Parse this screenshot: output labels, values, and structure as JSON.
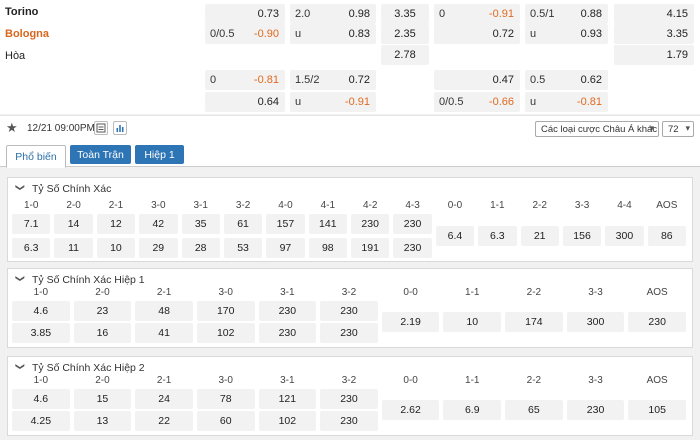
{
  "teams": {
    "home": "Torino",
    "away": "Bologna",
    "draw": "Hòa"
  },
  "odds": {
    "r1": {
      "a": "0.73",
      "b_l": "2.0",
      "b_r": "0.98",
      "c": "3.35",
      "d_l": "0",
      "d_r": "-0.91",
      "e_l": "0.5/1",
      "e_r": "0.88",
      "f": "4.15"
    },
    "r2": {
      "a_l": "0/0.5",
      "a_r": "-0.90",
      "b_l": "u",
      "b_r": "0.83",
      "c": "2.35",
      "d_r": "0.72",
      "e_l": "u",
      "e_r": "0.93",
      "f": "3.35"
    },
    "r3": {
      "c": "2.78",
      "f": "1.79"
    },
    "r4": {
      "a_l": "0",
      "a_r": "-0.81",
      "b_l": "1.5/2",
      "b_r": "0.72",
      "d_r": "0.47",
      "e_l": "0.5",
      "e_r": "0.62"
    },
    "r5": {
      "a_r": "0.64",
      "b_l": "u",
      "b_r": "-0.91",
      "d_l": "0/0.5",
      "d_r": "-0.66",
      "e_l": "u",
      "e_r": "-0.81"
    }
  },
  "toolbar": {
    "datetime": "12/21 09:00PM",
    "select_label": "Các loại cược Châu Á khác",
    "count": "72"
  },
  "tabs": [
    "Phổ biến",
    "Toàn Trận",
    "Hiệp 1"
  ],
  "sections": [
    {
      "title": "Tỷ Số Chính Xác",
      "home_labels": [
        "1-0",
        "2-0",
        "2-1",
        "3-0",
        "3-1",
        "3-2",
        "4-0",
        "4-1",
        "4-2",
        "4-3"
      ],
      "home_values": [
        "7.1",
        "14",
        "12",
        "42",
        "35",
        "61",
        "157",
        "141",
        "230",
        "230"
      ],
      "away_values": [
        "6.3",
        "11",
        "10",
        "29",
        "28",
        "53",
        "97",
        "98",
        "191",
        "230"
      ],
      "draw_labels": [
        "0-0",
        "1-1",
        "2-2",
        "3-3",
        "4-4",
        "AOS"
      ],
      "draw_values": [
        "6.4",
        "6.3",
        "21",
        "156",
        "300",
        "86"
      ]
    },
    {
      "title": "Tỷ Số Chính Xác Hiệp 1",
      "home_labels": [
        "1-0",
        "2-0",
        "2-1",
        "3-0",
        "3-1",
        "3-2"
      ],
      "home_values": [
        "4.6",
        "23",
        "48",
        "170",
        "230",
        "230"
      ],
      "away_values": [
        "3.85",
        "16",
        "41",
        "102",
        "230",
        "230"
      ],
      "draw_labels": [
        "0-0",
        "1-1",
        "2-2",
        "3-3",
        "AOS"
      ],
      "draw_values": [
        "2.19",
        "10",
        "174",
        "300",
        "230"
      ]
    },
    {
      "title": "Tỷ Số Chính Xác Hiệp 2",
      "home_labels": [
        "1-0",
        "2-0",
        "2-1",
        "3-0",
        "3-1",
        "3-2"
      ],
      "home_values": [
        "4.6",
        "15",
        "24",
        "78",
        "121",
        "230"
      ],
      "away_values": [
        "4.25",
        "13",
        "22",
        "60",
        "102",
        "230"
      ],
      "draw_labels": [
        "0-0",
        "1-1",
        "2-2",
        "3-3",
        "AOS"
      ],
      "draw_values": [
        "2.62",
        "6.9",
        "65",
        "230",
        "105"
      ]
    }
  ]
}
